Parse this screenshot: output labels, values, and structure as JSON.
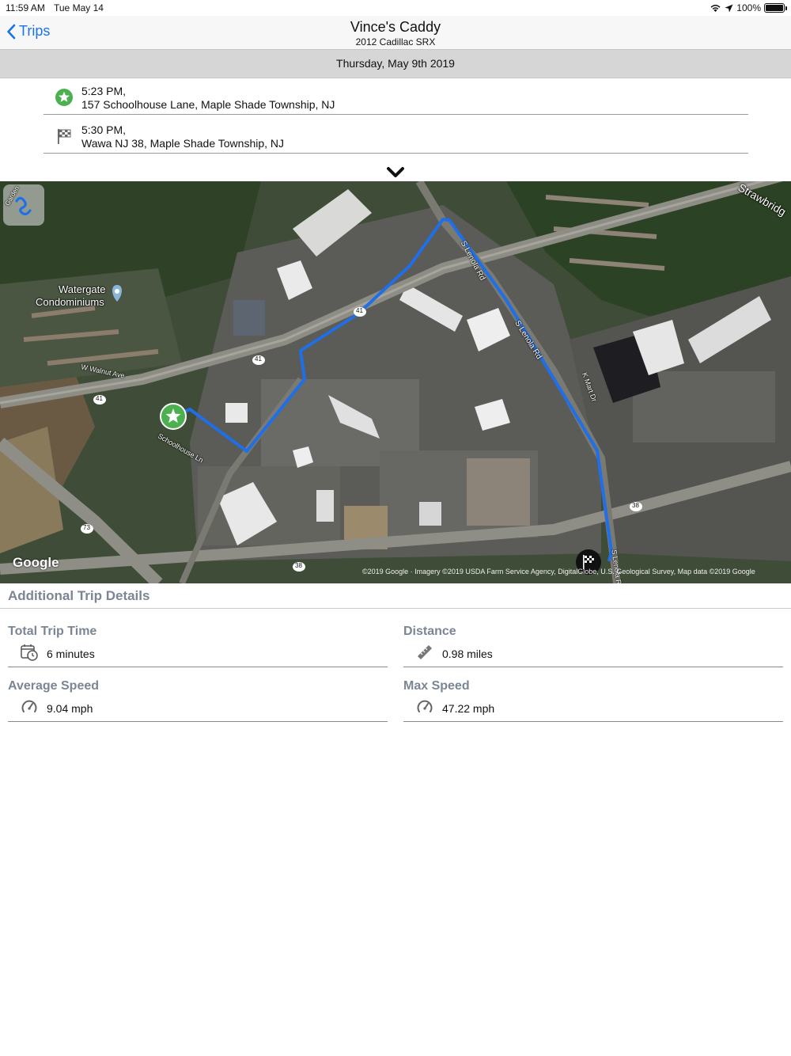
{
  "status_bar": {
    "time": "11:59 AM",
    "date": "Tue May 14",
    "battery": "100%"
  },
  "nav": {
    "back_label": "Trips",
    "title": "Vince's Caddy",
    "subtitle": "2012 Cadillac SRX"
  },
  "trip_date": "Thursday, May 9th 2019",
  "start": {
    "time": "5:23 PM,",
    "address": "157 Schoolhouse Lane, Maple Shade Township, NJ",
    "icon": "start-star-icon"
  },
  "end": {
    "time": "5:30 PM,",
    "address": "Wawa NJ 38, Maple Shade Township, NJ",
    "icon": "checkered-flag-icon"
  },
  "map": {
    "labels": {
      "watergate_1": "Watergate",
      "watergate_2": "Condominiums",
      "walnut": "W Walnut Ave",
      "schoolhouse": "Schoolhouse Ln",
      "lenola1": "S Lenola Rd",
      "lenola2": "S Lenola Rd",
      "lenola3": "S Lenola Rd",
      "kmart": "K Mart Dr",
      "strawbridge": "Strawbridg",
      "garden": "Garden",
      "r41a": "41",
      "r41b": "41",
      "r41c": "41",
      "r73": "73",
      "r38a": "38",
      "r38b": "38"
    },
    "google": "Google",
    "copyright": "©2019 Google · Imagery ©2019 USDA Farm Service Agency, DigitalGlobe, U.S. Geological Survey, Map data ©2019 Google",
    "route_color": "#1f6fe8"
  },
  "details": {
    "title": "Additional Trip Details",
    "total_time": {
      "label": "Total Trip Time",
      "value": "6 minutes"
    },
    "distance": {
      "label": "Distance",
      "value": "0.98 miles"
    },
    "avg_speed": {
      "label": "Average Speed",
      "value": "9.04 mph"
    },
    "max_speed": {
      "label": "Max Speed",
      "value": "47.22 mph"
    }
  },
  "colors": {
    "accent": "#1a73e8",
    "start_green": "#4caf50",
    "label_gray": "#7b8694"
  }
}
